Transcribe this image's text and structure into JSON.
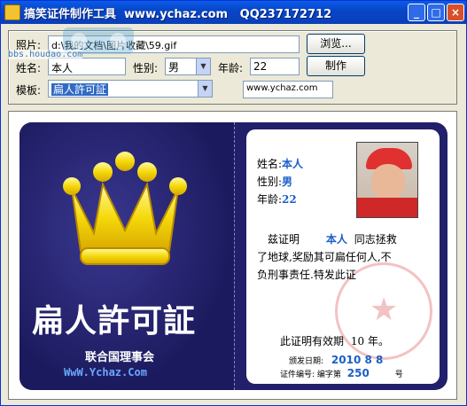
{
  "window": {
    "title": "搞笑证件制作工具  www.ychaz.com   QQ237172712",
    "buttons": [
      "_",
      "□",
      "×"
    ]
  },
  "form": {
    "photo_label": "照片:",
    "photo_path": "d:\\我的文档\\图片收藏\\59.gif",
    "browse_label": "浏览...",
    "name_label": "姓名:",
    "name_value": "本人",
    "gender_label": "性别:",
    "gender_value": "男",
    "age_label": "年龄:",
    "age_value": "22",
    "make_label": "制作",
    "template_label": "模板:",
    "template_value": "扁人許可証",
    "site_value": "www.ychaz.com",
    "watermark_site": "bbs.houdao.com"
  },
  "card": {
    "title": "扁人許可証",
    "org": "联合国理事会",
    "url": "WwW.Ychaz.Com",
    "name_label": "姓名:",
    "name": "本人",
    "gender_label": "性别:",
    "gender": "男",
    "age_label": "年龄:",
    "age": "22",
    "cert_prefix": "兹证明",
    "cert_name": "本人",
    "cert_text_1": "同志拯救",
    "cert_text_2": "了地球,奖励其可扁任何人,不",
    "cert_text_3": "负刑事责任.特发此证",
    "validity_prefix": "此证明有效期",
    "validity_years": "10",
    "validity_suffix": "年。",
    "issue_label": "颁发日期:",
    "issue_date": "2010 8 8",
    "number_label": "证件编号: 编字第",
    "number": "250",
    "number_suffix": "号"
  }
}
